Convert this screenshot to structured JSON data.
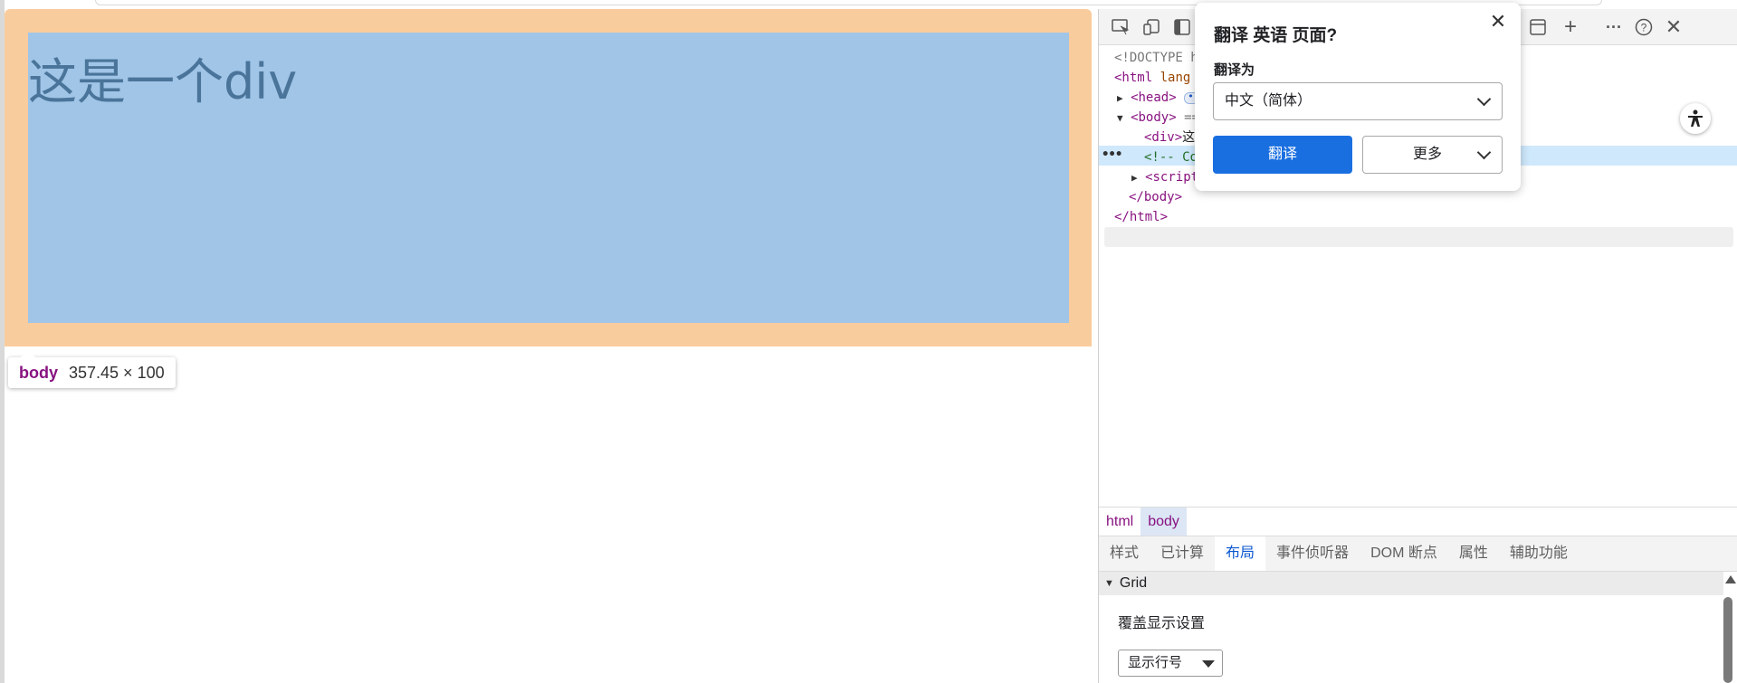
{
  "preview": {
    "div_text": "这是一个div",
    "tooltip": {
      "tag": "body",
      "size": "357.45 × 100"
    }
  },
  "devtools": {
    "toolbar_icons": [
      "inspect-icon",
      "device-icon",
      "dock-icon",
      "panel-icon",
      "add-icon",
      "more-icon",
      "help-icon",
      "close-icon"
    ],
    "dom": {
      "doctype": "<!DOCTYPE h",
      "html_open": "<html",
      "html_attr": "lang",
      "head": "<head>",
      "head_ellipsis": "•••",
      "body_open": "<body>",
      "body_eq": "==",
      "div_open": "<div>",
      "div_text": "这",
      "comment": "<!-- Co",
      "script": "<script",
      "body_close": "</body>",
      "html_close": "</html>"
    },
    "breadcrumbs": [
      "html",
      "body"
    ],
    "subtabs": [
      "样式",
      "已计算",
      "布局",
      "事件侦听器",
      "DOM 断点",
      "属性",
      "辅助功能"
    ],
    "layout": {
      "section": "Grid",
      "overlay_label": "覆盖显示设置",
      "select_value": "显示行号"
    }
  },
  "translate": {
    "title": "翻译 英语 页面?",
    "label": "翻译为",
    "language": "中文（简体）",
    "translate_button": "翻译",
    "more_button": "更多"
  },
  "colors": {
    "margin": "#f9cc9d",
    "content": "#a0c5e7",
    "accent": "#1a6fe0",
    "tag": "#881280"
  }
}
